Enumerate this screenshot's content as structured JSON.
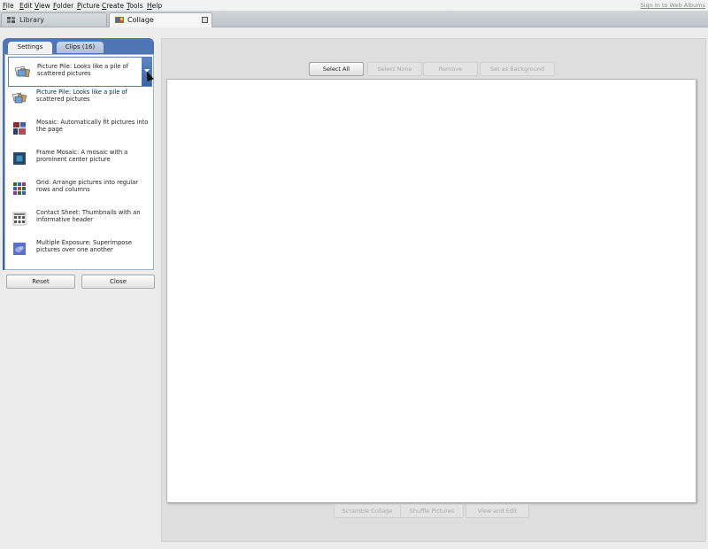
{
  "menu": {
    "items": [
      "File",
      "Edit",
      "View",
      "Folder",
      "Picture",
      "Create",
      "Tools",
      "Help"
    ],
    "signin": "Sign In to Web Albums"
  },
  "doc_tabs": {
    "library": "Library",
    "collage": "Collage"
  },
  "panel": {
    "tabs": {
      "settings": "Settings",
      "clips": "Clips (16)"
    },
    "selected": "Picture Pile:  Looks like a pile of scattered pictures",
    "options": [
      {
        "label": "Picture Pile:  Looks like a pile of scattered pictures",
        "icon": "picture-pile-icon"
      },
      {
        "label": "Mosaic:  Automatically fit pictures into the page",
        "icon": "mosaic-icon"
      },
      {
        "label": "Frame Mosaic: A mosaic with a prominent center picture",
        "icon": "frame-mosaic-icon"
      },
      {
        "label": "Grid:  Arrange pictures into regular rows and columns",
        "icon": "grid-icon"
      },
      {
        "label": "Contact Sheet:  Thumbnails with an informative header",
        "icon": "contact-sheet-icon"
      },
      {
        "label": "Multiple Exposure:  Superimpose pictures over one another",
        "icon": "multiple-exposure-icon"
      }
    ],
    "reset": "Reset",
    "close": "Close"
  },
  "toolbar": {
    "select_all": "Select All",
    "select_none": "Select None",
    "remove": "Remove",
    "set_background": "Set as Background"
  },
  "bottom_bar": {
    "scramble": "Scramble Collage",
    "shuffle": "Shuffle Pictures",
    "view_edit": "View and Edit"
  }
}
